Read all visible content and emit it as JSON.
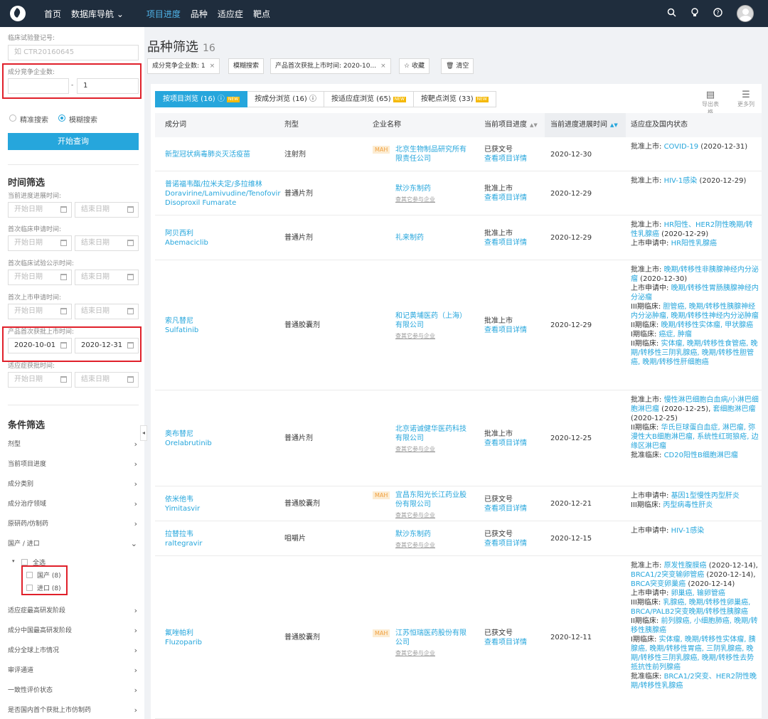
{
  "nav": {
    "items": [
      "首页",
      "数据库导航 ⌄",
      "项目进度",
      "品种",
      "适应症",
      "靶点"
    ],
    "active_index": 2,
    "icons": [
      "search-icon",
      "bulb-icon",
      "help-icon",
      "avatar"
    ]
  },
  "sidebar": {
    "trial_label": "临床试验登记号:",
    "trial_placeholder": "如 CTR20160645",
    "competitor_label": "成分竞争企业数:",
    "competitor_from": "",
    "competitor_sep": "-",
    "competitor_to": "1",
    "search_modes": [
      "精准搜索",
      "模糊搜索"
    ],
    "search_mode_selected": 1,
    "query_button": "开始查询",
    "time_title": "时间筛选",
    "time_filters": [
      {
        "label": "当前进度进展时间:",
        "start": "开始日期",
        "end": "结束日期",
        "filled": false
      },
      {
        "label": "首次临床申请时间:",
        "start": "开始日期",
        "end": "结束日期",
        "filled": false
      },
      {
        "label": "首次临床试验公示时间:",
        "start": "开始日期",
        "end": "结束日期",
        "filled": false
      },
      {
        "label": "首次上市申请时间:",
        "start": "开始日期",
        "end": "结束日期",
        "filled": false
      },
      {
        "label": "产品首次获批上市时间:",
        "start": "2020-10-01",
        "end": "2020-12-31",
        "filled": true
      },
      {
        "label": "适应症获批时间:",
        "start": "开始日期",
        "end": "结束日期",
        "filled": false
      }
    ],
    "cond_title": "条件筛选",
    "conditions_a": [
      "剂型",
      "当前项目进度",
      "成分类别",
      "成分治疗领域",
      "原研药/仿制药",
      "国产 / 进口"
    ],
    "origin_all": "全选",
    "origin_options": [
      "国产 (8)",
      "进口 (8)"
    ],
    "conditions_b": [
      "适应症最高研发阶段",
      "成分中国最高研发阶段",
      "成分全球上市情况",
      "审评通道",
      "一致性评价状态",
      "是否国内首个获批上市仿制药"
    ],
    "collapse": "◂"
  },
  "main": {
    "title": "品种筛选",
    "count": "16",
    "chips": [
      "成分竞争企业数: 1",
      "模糊搜索",
      "产品首次获批上市时间: 2020-10...",
      "收藏",
      "清空"
    ],
    "tabs": [
      {
        "label": "按项目浏览 (16) ⓘ",
        "new": "NEW"
      },
      {
        "label": "按成分浏览 (16) ⓘ",
        "new": ""
      },
      {
        "label": "按适应症浏览 (65)",
        "new": "NEW"
      },
      {
        "label": "按靶点浏览 (33)",
        "new": "NEW"
      }
    ],
    "tools": [
      "导出表格",
      "更多列"
    ],
    "columns": [
      "成分词",
      "剂型",
      "企业名称",
      "当前项目进度",
      "当前进度进展时间",
      "适应症及国内状态"
    ],
    "detail_link": "查看项目详情",
    "more_companies": "查其它参与企业",
    "rows": [
      {
        "name_cn": "新型冠状病毒肺炎灭活疫苗",
        "name_en": "",
        "form": "注射剂",
        "mah": "MAH",
        "company": "北京生物制品研究所有限责任公司",
        "sub": "",
        "progress": "已获文号",
        "date": "2020-12-30",
        "ind": [
          {
            "pre": "批准上市: ",
            "link": "COVID-19",
            "post": " (2020-12-31)"
          }
        ]
      },
      {
        "name_cn": "普诺福韦酯/拉米夫定/多拉维林",
        "name_en": "Doravirine/Lamivudine/Tenofovir Disoproxil Fumarate",
        "form": "普通片剂",
        "mah": "",
        "company": "默沙东制药",
        "sub": "查其它参与企业",
        "progress": "批准上市",
        "date": "2020-12-29",
        "ind": [
          {
            "pre": "批准上市: ",
            "link": "HIV-1感染",
            "post": " (2020-12-29)"
          }
        ]
      },
      {
        "name_cn": "阿贝西利",
        "name_en": "Abemaciclib",
        "form": "普通片剂",
        "mah": "",
        "company": "礼来制药",
        "sub": "",
        "progress": "批准上市",
        "date": "2020-12-29",
        "ind": [
          {
            "pre": "批准上市: ",
            "link": "HR阳性、HER2阴性晚期/转性乳腺癌",
            "post": " (2020-12-29)"
          },
          {
            "pre": "上市申请中: ",
            "link": "HR阳性乳腺癌",
            "post": ""
          }
        ]
      },
      {
        "name_cn": "索凡替尼",
        "name_en": "Sulfatinib",
        "form": "普通胶囊剂",
        "mah": "",
        "company": "和记黄埔医药（上海）有限公司",
        "sub": "查其它参与企业",
        "progress": "批准上市",
        "date": "2020-12-29",
        "ind": [
          {
            "pre": "批准上市: ",
            "link": "晚期/转移性非胰腺神经内分泌瘤",
            "post": " (2020-12-30)"
          },
          {
            "pre": "上市申请中: ",
            "link": "晚期/转移性胃肠胰腺神经内分泌瘤",
            "post": ""
          },
          {
            "pre": "III期临床: ",
            "link": "胆管癌, 晚期/转移性胰腺神经内分泌肿瘤, 晚期/转移性神经内分泌肿瘤",
            "post": ""
          },
          {
            "pre": "II期临床: ",
            "link": "晚期/转移性实体瘤, 甲状腺癌",
            "post": ""
          },
          {
            "pre": "I期临床: ",
            "link": "癌症, 肿瘤",
            "post": ""
          },
          {
            "pre": "II期临床: ",
            "link": "实体瘤, 晚期/转移性食管癌, 晚期/转移性三阴乳腺癌, 晚期/转移性胆管癌, 晚期/转移性肝细胞癌",
            "post": ""
          }
        ]
      },
      {
        "name_cn": "奥布替尼",
        "name_en": "Orelabrutinib",
        "form": "普通片剂",
        "mah": "",
        "company": "北京诺诚健华医药科技有限公司",
        "sub": "查其它参与企业",
        "progress": "批准上市",
        "date": "2020-12-25",
        "ind": [
          {
            "pre": "批准上市: ",
            "link": "慢性淋巴细胞白血病/小淋巴细胞淋巴瘤",
            "post": " (2020-12-25), "
          },
          {
            "pre": "",
            "link": "套细胞淋巴瘤",
            "post": " (2020-12-25)"
          },
          {
            "pre": "II期临床: ",
            "link": "华氏巨球蛋白血症, 淋巴瘤, 弥漫性大B细胞淋巴瘤, 系统性红斑狼疮, 边缘区淋巴瘤",
            "post": ""
          },
          {
            "pre": "批准临床: ",
            "link": "CD20阳性B细胞淋巴瘤",
            "post": ""
          }
        ]
      },
      {
        "name_cn": "依米他韦",
        "name_en": "Yimitasvir",
        "form": "普通胶囊剂",
        "mah": "MAH",
        "company": "宜昌东阳光长江药业股份有限公司",
        "sub": "查其它参与企业",
        "progress": "已获文号",
        "date": "2020-12-21",
        "ind": [
          {
            "pre": "上市申请中: ",
            "link": "基因1型慢性丙型肝炎",
            "post": ""
          },
          {
            "pre": "III期临床: ",
            "link": "丙型病毒性肝炎",
            "post": ""
          }
        ]
      },
      {
        "name_cn": "拉替拉韦",
        "name_en": "raltegravir",
        "form": "咀嚼片",
        "mah": "",
        "company": "默沙东制药",
        "sub": "查其它参与企业",
        "progress": "已获文号",
        "date": "2020-12-15",
        "ind": [
          {
            "pre": "上市申请中: ",
            "link": "HIV-1感染",
            "post": ""
          }
        ]
      },
      {
        "name_cn": "氟唑帕利",
        "name_en": "Fluzoparib",
        "form": "普通胶囊剂",
        "mah": "MAH",
        "company": "江苏恒瑞医药股份有限公司",
        "sub": "查其它参与企业",
        "progress": "已获文号",
        "date": "2020-12-11",
        "ind": [
          {
            "pre": "批准上市: ",
            "link": "原发性腹膜癌",
            "post": " (2020-12-14), "
          },
          {
            "pre": "",
            "link": "BRCA1/2突变输卵管癌",
            "post": " (2020-12-14), "
          },
          {
            "pre": "",
            "link": "BRCA突变卵巢癌",
            "post": " (2020-12-14)"
          },
          {
            "pre": "上市申请中: ",
            "link": "卵巢癌, 输卵管癌",
            "post": ""
          },
          {
            "pre": "III期临床: ",
            "link": "乳腺癌, 晚期/转移性卵巢癌, BRCA/PALB2突变晚期/转移性胰腺癌",
            "post": ""
          },
          {
            "pre": "II期临床: ",
            "link": "前列腺癌, 小细胞肺癌, 晚期/转移性胰腺癌",
            "post": ""
          },
          {
            "pre": "I期临床: ",
            "link": "实体瘤, 晚期/转移性实体瘤, 胰腺癌, 晚期/转移性胃癌, 三阴乳腺癌, 晚期/转移性三阴乳腺癌, 晚期/转移性去势抵抗性前列腺癌",
            "post": ""
          },
          {
            "pre": "批准临床: ",
            "link": "BRCA1/2突变、HER2阴性晚期/转移性乳腺癌",
            "post": ""
          }
        ]
      }
    ]
  }
}
